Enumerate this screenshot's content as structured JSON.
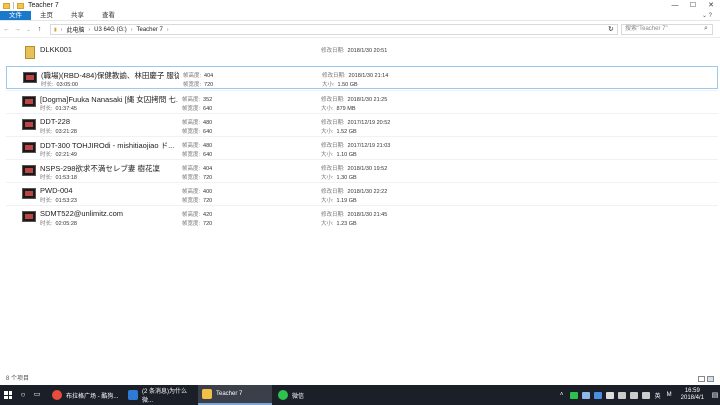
{
  "window": {
    "title": "Teacher 7",
    "controls": {
      "minimize": "—",
      "maximize": "☐",
      "close": "✕"
    }
  },
  "ribbon": {
    "tabs": [
      "文件",
      "主页",
      "共享",
      "查看"
    ],
    "right": "⌄ ?"
  },
  "address": {
    "breadcrumbs": [
      "此电脑",
      "U3 64G (G:)",
      "Teacher 7"
    ],
    "search_placeholder": "搜索\"Teacher 7\""
  },
  "labels": {
    "duration": "时长:",
    "frame_height": "帧高度:",
    "frame_width": "帧宽度:",
    "modified": "修改日期:",
    "size": "大小:"
  },
  "items": [
    {
      "name": "DLKK001",
      "type": "folder",
      "modified": "2018/1/30 20:51"
    },
    {
      "name": "(職場)(RBD-484)保健教諭、林田慶子 服従...",
      "duration": "03:05:00",
      "height": "404",
      "width": "720",
      "modified": "2018/1/30 21:14",
      "size": "1.50 GB",
      "selected": true
    },
    {
      "name": "[Dogma]Fuuka Nanasaki [縄 女囚拷問 七...",
      "duration": "01:37:45",
      "height": "352",
      "width": "640",
      "modified": "2018/1/30 21:25",
      "size": "879 MB"
    },
    {
      "name": "DDT-228",
      "duration": "03:21:28",
      "height": "480",
      "width": "640",
      "modified": "2017/12/19 20:52",
      "size": "1.52 GB"
    },
    {
      "name": "DDT-300 TOHJIROdi - mishitiaojiao ド...",
      "duration": "02:21:49",
      "height": "480",
      "width": "640",
      "modified": "2017/12/19 21:03",
      "size": "1.10 GB"
    },
    {
      "name": "NSPS-298欲求不満セレブ妻 樹花凜",
      "duration": "01:53:18",
      "height": "404",
      "width": "720",
      "modified": "2018/1/30 19:52",
      "size": "1.30 GB"
    },
    {
      "name": "PWD-004",
      "duration": "01:53:23",
      "height": "400",
      "width": "720",
      "modified": "2018/1/30 22:22",
      "size": "1.19 GB"
    },
    {
      "name": "SDMT522@unlimitz.com",
      "duration": "02:05:28",
      "height": "420",
      "width": "720",
      "modified": "2018/1/30 21:45",
      "size": "1.23 GB"
    }
  ],
  "status": {
    "count": "8 个项目"
  },
  "taskbar": {
    "apps": [
      {
        "label": "布拉格广场 - 酷狗...",
        "color": "#e84c3d"
      },
      {
        "label": "(2 条消息)为什么微...",
        "color": "#2e7bd6"
      },
      {
        "label": "Teacher 7",
        "color": "#f1c048"
      },
      {
        "label": "微信",
        "color": "#2dc24d"
      }
    ],
    "ime": "英",
    "ime2": "M",
    "time": "16:59",
    "date": "2018/4/1"
  }
}
